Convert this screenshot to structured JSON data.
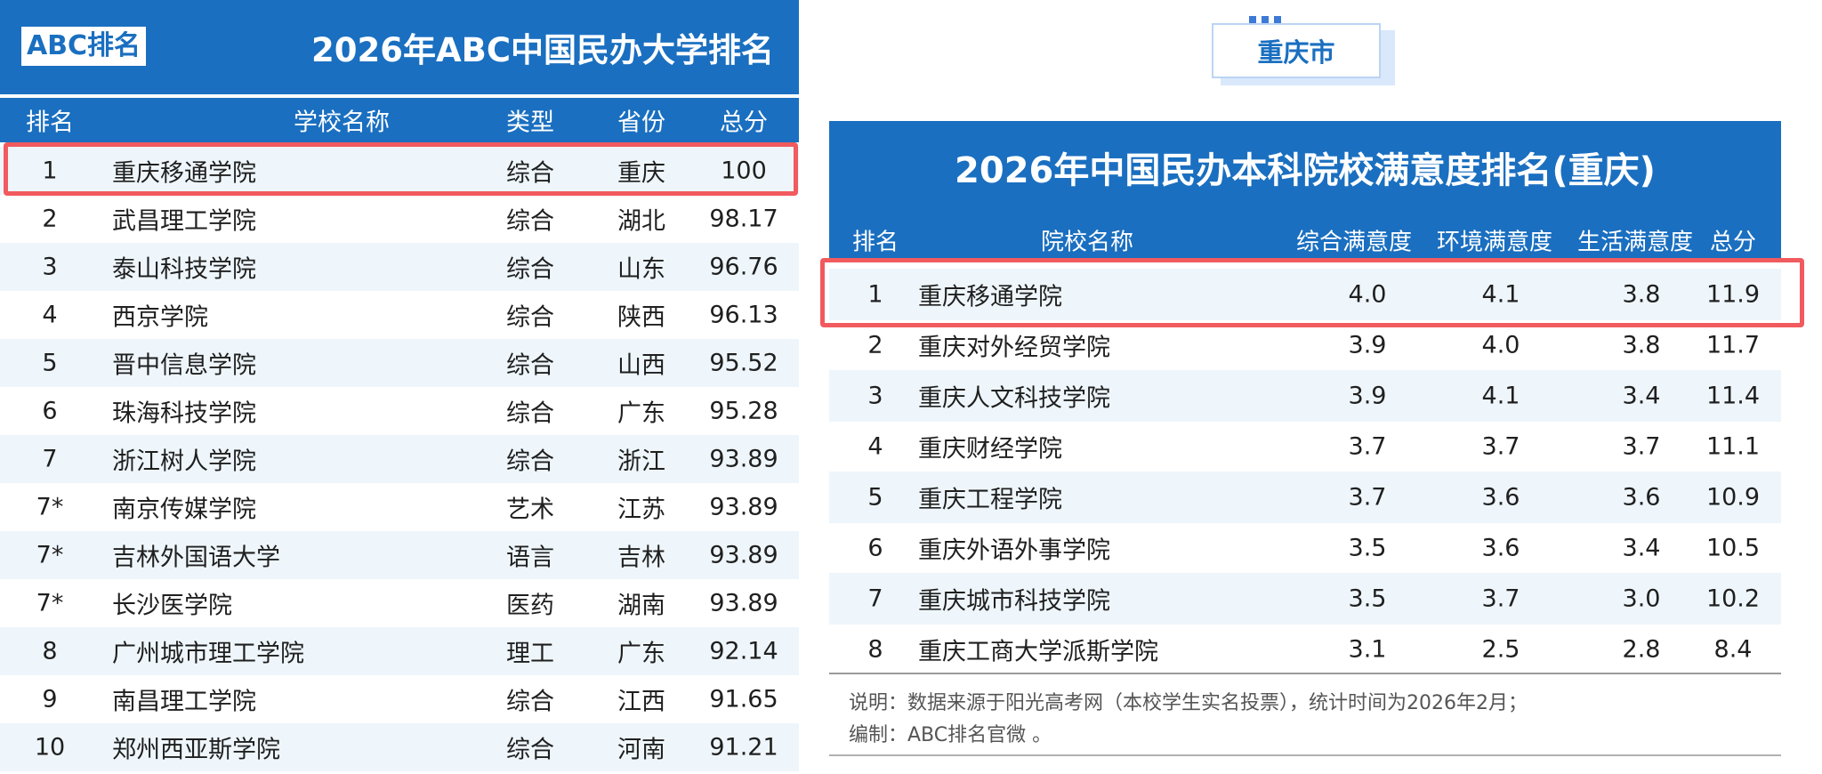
{
  "left": {
    "logo": "ABC排名",
    "title": "2026年ABC中国民办大学排名",
    "headers": [
      "排名",
      "学校名称",
      "类型",
      "省份",
      "总分"
    ],
    "rows": [
      [
        "1",
        "重庆移通学院",
        "综合",
        "重庆",
        "100"
      ],
      [
        "2",
        "武昌理工学院",
        "综合",
        "湖北",
        "98.17"
      ],
      [
        "3",
        "泰山科技学院",
        "综合",
        "山东",
        "96.76"
      ],
      [
        "4",
        "西京学院",
        "综合",
        "陕西",
        "96.13"
      ],
      [
        "5",
        "晋中信息学院",
        "综合",
        "山西",
        "95.52"
      ],
      [
        "6",
        "珠海科技学院",
        "综合",
        "广东",
        "95.28"
      ],
      [
        "7",
        "浙江树人学院",
        "综合",
        "浙江",
        "93.89"
      ],
      [
        "7*",
        "南京传媒学院",
        "艺术",
        "江苏",
        "93.89"
      ],
      [
        "7*",
        "吉林外国语大学",
        "语言",
        "吉林",
        "93.89"
      ],
      [
        "7*",
        "长沙医学院",
        "医药",
        "湖南",
        "93.89"
      ],
      [
        "8",
        "广州城市理工学院",
        "理工",
        "广东",
        "92.14"
      ],
      [
        "9",
        "南昌理工学院",
        "综合",
        "江西",
        "91.65"
      ],
      [
        "10",
        "郑州西亚斯学院",
        "综合",
        "河南",
        "91.21"
      ]
    ]
  },
  "right": {
    "city_tag": "重庆市",
    "title": "2026年中国民办本科院校满意度排名(重庆)",
    "headers": [
      "排名",
      "院校名称",
      "综合满意度",
      "环境满意度",
      "生活满意度",
      "总分"
    ],
    "rows": [
      [
        "1",
        "重庆移通学院",
        "4.0",
        "4.1",
        "3.8",
        "11.9"
      ],
      [
        "2",
        "重庆对外经贸学院",
        "3.9",
        "4.0",
        "3.8",
        "11.7"
      ],
      [
        "3",
        "重庆人文科技学院",
        "3.9",
        "4.1",
        "3.4",
        "11.4"
      ],
      [
        "4",
        "重庆财经学院",
        "3.7",
        "3.7",
        "3.7",
        "11.1"
      ],
      [
        "5",
        "重庆工程学院",
        "3.7",
        "3.6",
        "3.6",
        "10.9"
      ],
      [
        "6",
        "重庆外语外事学院",
        "3.5",
        "3.6",
        "3.4",
        "10.5"
      ],
      [
        "7",
        "重庆城市科技学院",
        "3.5",
        "3.7",
        "3.0",
        "10.2"
      ],
      [
        "8",
        "重庆工商大学派斯学院",
        "3.1",
        "2.5",
        "2.8",
        "8.4"
      ]
    ],
    "note_1": "说明：数据来源于阳光高考网（本校学生实名投票），统计时间为2026年2月；",
    "note_2": "编制：ABC排名官微 。"
  },
  "colors": {
    "header_blue": "#1a6fc0",
    "row_shade": "#eef6fb",
    "highlight_red": "#f15a5e"
  }
}
